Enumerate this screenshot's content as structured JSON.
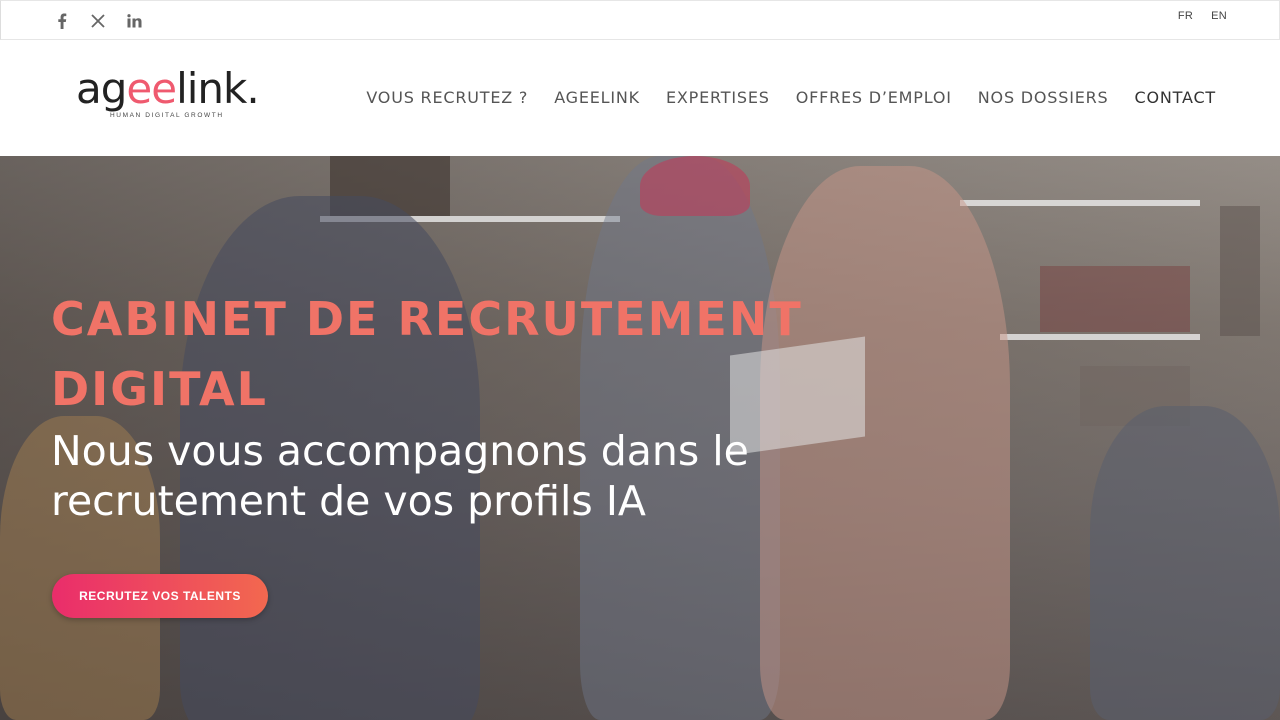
{
  "topbar": {
    "social": [
      {
        "icon": "facebook-icon",
        "glyph": "f"
      },
      {
        "icon": "x-twitter-icon",
        "glyph": "𝕏"
      },
      {
        "icon": "linkedin-icon",
        "glyph": "in"
      }
    ],
    "languages": [
      "FR",
      "EN"
    ]
  },
  "header": {
    "logo": {
      "part1": "ag",
      "accent": "ee",
      "part2": "link.",
      "tagline": "HUMAN DIGITAL GROWTH"
    },
    "nav": [
      "VOUS RECRUTEZ ?",
      "AGEELINK",
      "EXPERTISES",
      "OFFRES D’EMPLOI",
      "NOS DOSSIERS",
      "CONTACT"
    ]
  },
  "hero": {
    "title": "CABINET DE RECRUTEMENT DIGITAL",
    "subtitle": "Nous vous accompagnons dans le recrutement de vos profils IA",
    "cta": "RECRUTEZ VOS TALENTS"
  },
  "colors": {
    "accent": "#f07367",
    "cta_start": "#ea2d6b",
    "cta_end": "#f2684f"
  }
}
